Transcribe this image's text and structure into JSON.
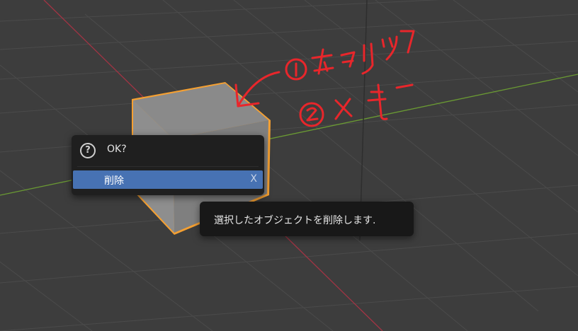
{
  "viewport": {
    "name": "3D Viewport",
    "colors": {
      "background": "#3d3d3d",
      "grid": "#4b4b4b",
      "x_axis": "#a23444",
      "y_axis": "#6a9a33",
      "outline": "#f5a032",
      "annotation": "#e8262b"
    }
  },
  "confirm_popup": {
    "title": "OK?",
    "icon": "question-circle-icon",
    "item": {
      "label": "削除",
      "shortcut": "X"
    }
  },
  "tooltip": {
    "text": "選択したオブジェクトを削除します."
  },
  "annotation": {
    "note": "handwritten red annotation: ① 左クリック ② Xキー with arrow pointing to cube"
  }
}
